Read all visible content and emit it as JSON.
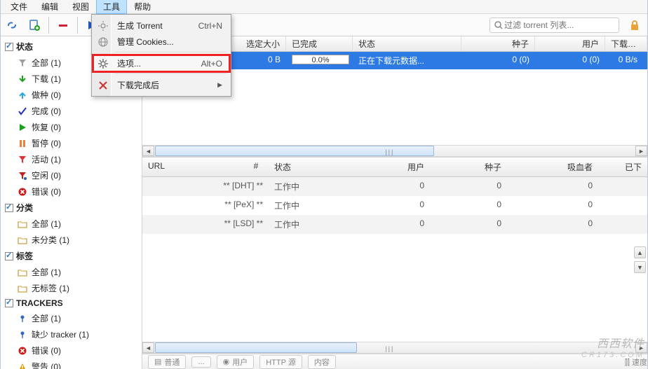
{
  "menubar": {
    "file": "文件",
    "edit": "编辑",
    "view": "视图",
    "tools": "工具",
    "help": "帮助"
  },
  "tools_menu": {
    "gen_torrent": "生成 Torrent",
    "gen_torrent_sc": "Ctrl+N",
    "manage_cookies": "管理 Cookies...",
    "options": "选项...",
    "options_sc": "Alt+O",
    "after_download": "下载完成后"
  },
  "search": {
    "placeholder": "过滤 torrent 列表..."
  },
  "sidebar": {
    "status": {
      "head": "状态",
      "items": [
        {
          "label": "全部 (1)",
          "icon": "funnel",
          "color": "#a0a0a0"
        },
        {
          "label": "下载 (1)",
          "icon": "arrow-down",
          "color": "#1aa11a"
        },
        {
          "label": "做种 (0)",
          "icon": "arrow-up",
          "color": "#23a7de"
        },
        {
          "label": "完成 (0)",
          "icon": "check",
          "color": "#2432c4"
        },
        {
          "label": "恢复 (0)",
          "icon": "play",
          "color": "#1aa11a"
        },
        {
          "label": "暂停 (0)",
          "icon": "pause",
          "color": "#f08040"
        },
        {
          "label": "活动 (1)",
          "icon": "funnel",
          "color": "#e03030"
        },
        {
          "label": "空闲 (0)",
          "icon": "funnel-dot",
          "color": "#c02020"
        },
        {
          "label": "错误 (0)",
          "icon": "err",
          "color": "#d01818"
        }
      ]
    },
    "category": {
      "head": "分类",
      "items": [
        {
          "label": "全部 (1)",
          "icon": "folder"
        },
        {
          "label": "未分类 (1)",
          "icon": "folder"
        }
      ]
    },
    "tags": {
      "head": "标签",
      "items": [
        {
          "label": "全部 (1)",
          "icon": "folder"
        },
        {
          "label": "无标签 (1)",
          "icon": "folder"
        }
      ]
    },
    "trackers": {
      "head": "TRACKERS",
      "items": [
        {
          "label": "全部 (1)",
          "icon": "tracker",
          "color": "#3464c4"
        },
        {
          "label": "缺少 tracker (1)",
          "icon": "tracker",
          "color": "#3464c4"
        },
        {
          "label": "错误 (0)",
          "icon": "err",
          "color": "#d01818"
        },
        {
          "label": "警告 (0)",
          "icon": "warn",
          "color": "#e2a000"
        }
      ]
    }
  },
  "transfer_head": {
    "name": "#",
    "size": "选定大小",
    "done": "已完成",
    "stat": "状态",
    "seed": "种子",
    "user": "用户",
    "speed": "下载速度"
  },
  "transfers": [
    {
      "name": "",
      "size": "0 B",
      "done": "0.0%",
      "stat": "正在下载元数据...",
      "seed": "0 (0)",
      "user": "0 (0)",
      "speed": "0 B/s"
    }
  ],
  "tracker_head": {
    "hash": "#",
    "url": "URL",
    "st": "状态",
    "u": "用户",
    "se": "种子",
    "xi": "吸血者",
    "yi": "已下"
  },
  "trackers": [
    {
      "url": "** [DHT] **",
      "st": "工作中",
      "u": "0",
      "se": "0",
      "xi": "0"
    },
    {
      "url": "** [PeX] **",
      "st": "工作中",
      "u": "0",
      "se": "0",
      "xi": "0"
    },
    {
      "url": "** [LSD] **",
      "st": "工作中",
      "u": "0",
      "se": "0",
      "xi": "0"
    }
  ],
  "statusbar": {
    "a": "普通",
    "b": "...",
    "c": "用户",
    "d": "HTTP 源",
    "e": "内容",
    "speed": "速度"
  },
  "watermark": {
    "a": "西西软件",
    "b": "CR173.COM"
  }
}
